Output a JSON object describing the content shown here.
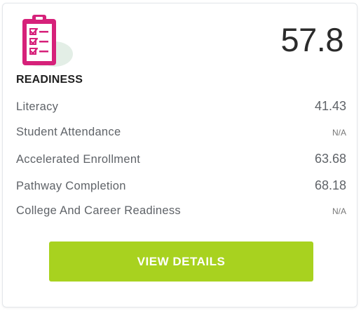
{
  "card": {
    "icon": "clipboard-checklist-icon",
    "score": "57.8",
    "title": "READINESS",
    "metrics": [
      {
        "label": "Literacy",
        "value": "41.43"
      },
      {
        "label": "Student Attendance",
        "value": "N/A"
      },
      {
        "label": "Accelerated Enrollment",
        "value": "63.68"
      },
      {
        "label": "Pathway Completion",
        "value": "68.18"
      },
      {
        "label": "College And Career Readiness",
        "value": "N/A"
      }
    ],
    "button_label": "VIEW DETAILS"
  },
  "colors": {
    "icon_magenta": "#d6217a",
    "icon_blob": "#e3eee6",
    "button_green": "#a8d21f",
    "text_dark": "#2b2b2b",
    "text_muted": "#5f6368"
  }
}
